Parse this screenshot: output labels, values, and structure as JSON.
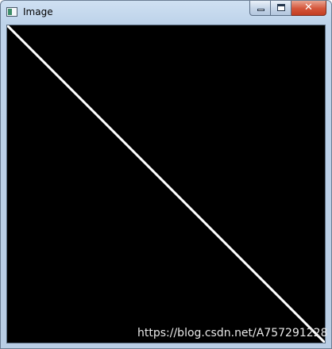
{
  "window": {
    "title": "Image",
    "icon": "app-window-icon",
    "buttons": {
      "minimize_icon": "minimize-icon",
      "maximize_icon": "maximize-icon",
      "close_icon": "close-icon",
      "close_glyph": "✕"
    }
  },
  "image": {
    "background_color": "#000000",
    "line_color": "#ffffff",
    "description_shape": "diagonal-line-top-left-to-bottom-right"
  },
  "watermark": {
    "text": "https://blog.csdn.net/A757291228"
  }
}
